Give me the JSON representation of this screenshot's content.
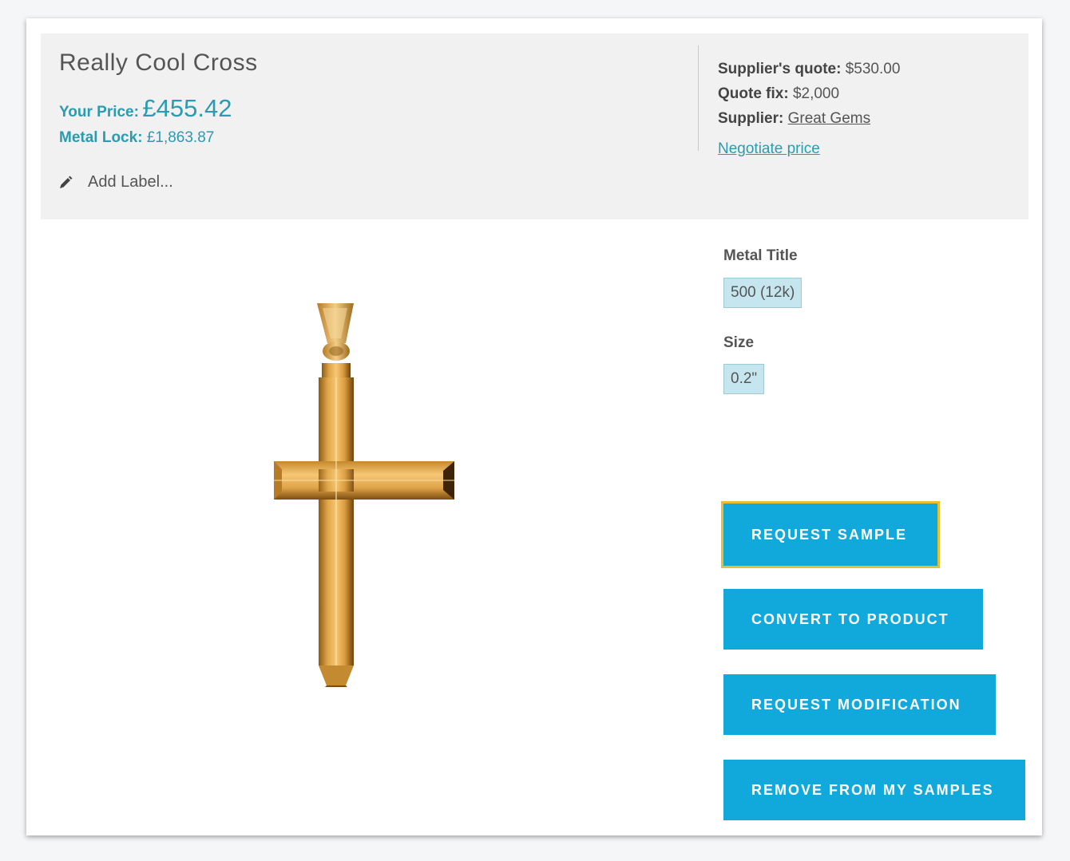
{
  "product": {
    "title": "Really Cool Cross",
    "your_price_label": "Your Price:",
    "your_price_value": "£455.42",
    "metal_lock_label": "Metal Lock:",
    "metal_lock_value": "£1,863.87",
    "add_label_text": "Add Label..."
  },
  "quote": {
    "supplier_quote_label": "Supplier's quote:",
    "supplier_quote_value": "$530.00",
    "quote_fix_label": "Quote fix:",
    "quote_fix_value": "$2,000",
    "supplier_label": "Supplier:",
    "supplier_name": "Great Gems",
    "negotiate_link": "Negotiate price"
  },
  "options": {
    "metal_title_label": "Metal Title",
    "metal_title_value": "500 (12k)",
    "size_label": "Size",
    "size_value": "0.2\""
  },
  "actions": {
    "request_sample": "REQUEST SAMPLE",
    "convert_to_product": "CONVERT TO PRODUCT",
    "request_modification": "REQUEST MODIFICATION",
    "remove_from_samples": "REMOVE FROM MY SAMPLES"
  },
  "colors": {
    "accent": "#2a9bb0",
    "button": "#11a8dc",
    "focus_outline": "#e9bf2f",
    "chip": "#c6e6ef",
    "header_bg": "#f1f1f1"
  },
  "icons": {
    "add_label": "pencil-icon",
    "product_image": "gold-cross-pendant"
  }
}
